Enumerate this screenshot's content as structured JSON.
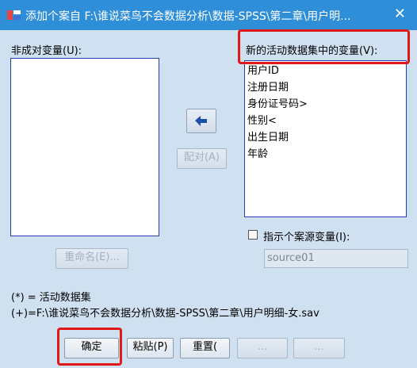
{
  "window": {
    "title": "添加个案自 F:\\谁说菜鸟不会数据分析\\数据-SPSS\\第二章\\用户明...",
    "close_glyph": "✕"
  },
  "unpaired": {
    "label": "非成对变量(U):",
    "items": []
  },
  "active": {
    "label": "新的活动数据集中的变量(V):",
    "items": [
      "用户ID",
      "注册日期",
      "身份证号码>",
      "性别<",
      "出生日期",
      "年龄"
    ]
  },
  "buttons": {
    "pair": "配对(A)",
    "rename": "重命名(E)...",
    "ok": "确定",
    "paste": "粘贴(P)",
    "reset": "重置(",
    "cancel": "...",
    "help": "..."
  },
  "source": {
    "checkbox_label": "指示个案源变量(I):",
    "field_value": "source01"
  },
  "notes": {
    "star": "(*) = 活动数据集",
    "plus": "(+)=F:\\谁说菜鸟不会数据分析\\数据-SPSS\\第二章\\用户明细-女.sav"
  },
  "colors": {
    "title_bar": "#2f8ed8",
    "background": "#cfe0f1",
    "highlight": "#e11818"
  }
}
